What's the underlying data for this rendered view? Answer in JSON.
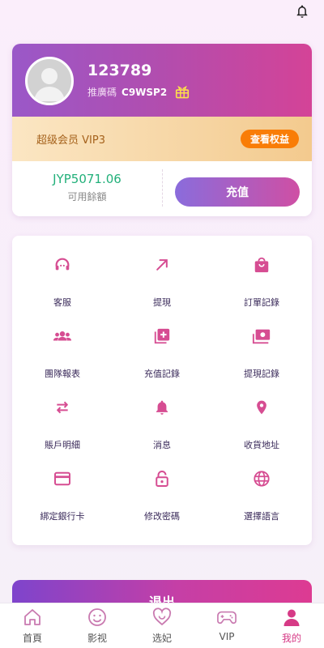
{
  "colors": {
    "accent": "#c24ba3",
    "icon": "#d64d92",
    "vip_button": "#f97d07",
    "balance_green": "#22b07a",
    "tab_active": "#d63a86"
  },
  "profile": {
    "username": "123789",
    "promo_label": "推廣碼",
    "promo_code": "C9WSP2"
  },
  "vip": {
    "label": "超级会员 VIP3",
    "button": "查看权益"
  },
  "balance": {
    "value": "JYP5071.06",
    "label": "可用餘額",
    "recharge_button": "充值"
  },
  "menu": [
    {
      "label": "客服",
      "icon": "headset-icon"
    },
    {
      "label": "提現",
      "icon": "arrow-up-right-icon"
    },
    {
      "label": "訂單記錄",
      "icon": "shopping-bag-icon"
    },
    {
      "label": "團隊報表",
      "icon": "team-icon"
    },
    {
      "label": "充值記錄",
      "icon": "add-box-icon"
    },
    {
      "label": "提現記錄",
      "icon": "cash-icon"
    },
    {
      "label": "賬戶明細",
      "icon": "swap-icon"
    },
    {
      "label": "消息",
      "icon": "bell-icon"
    },
    {
      "label": "收貨地址",
      "icon": "location-pin-icon"
    },
    {
      "label": "綁定銀行卡",
      "icon": "credit-card-icon"
    },
    {
      "label": "修改密碼",
      "icon": "lock-icon"
    },
    {
      "label": "選擇語言",
      "icon": "globe-icon"
    }
  ],
  "logout": "退出",
  "tabs": [
    {
      "label": "首頁",
      "icon": "home-icon",
      "active": false
    },
    {
      "label": "影视",
      "icon": "smile-icon",
      "active": false
    },
    {
      "label": "选妃",
      "icon": "heart-icon",
      "active": false
    },
    {
      "label": "VIP",
      "icon": "gamepad-icon",
      "active": false
    },
    {
      "label": "我的",
      "icon": "user-icon",
      "active": true
    }
  ]
}
